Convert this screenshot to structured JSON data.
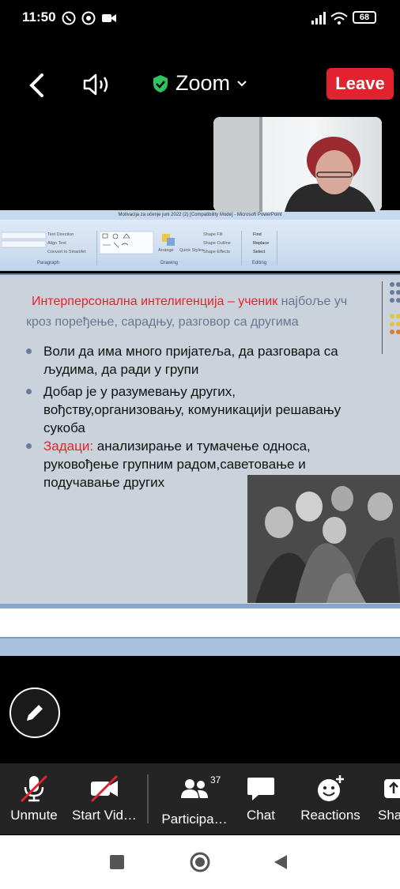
{
  "status_bar": {
    "time": "11:50",
    "battery": "68"
  },
  "top_bar": {
    "title": "Zoom",
    "leave_label": "Leave"
  },
  "ppt": {
    "window_title": "Motivacija za učenje juni 2022 (2) [Compatibility Mode] - Microsoft PowerPoint",
    "ribbon": {
      "paragraph_label": "Paragraph",
      "drawing_label": "Drawing",
      "editing_label": "Editing",
      "text_direction": "Text Direction",
      "align_text": "Align Text",
      "convert_smartart": "Convert to SmartArt",
      "arrange": "Arrange",
      "quick_styles": "Quick Styles",
      "shape_fill": "Shape Fill",
      "shape_outline": "Shape Outline",
      "shape_effects": "Shape Effects",
      "find": "Find",
      "replace": "Replace",
      "select": "Select"
    }
  },
  "slide": {
    "heading_red": "Интерперсонална интелигенција – ученик",
    "heading_rest": " најбоље уч",
    "heading_line2": "кроз поређење, сарадњу, разговор са другима",
    "bullets": [
      {
        "lines": [
          "Воли да има много пријатеља, да разговара са",
          "људима, да ради у групи"
        ]
      },
      {
        "lines": [
          "Добар је у разумевању других,",
          "вођству,организовању, комуникацији решавању",
          "сукоба"
        ]
      },
      {
        "label": "Задаци:",
        "lines": [
          "  анализирање и тумачење односа,",
          "руковођење групним радом,саветовање и",
          "подучавање других"
        ]
      }
    ]
  },
  "toolbar": {
    "unmute": "Unmute",
    "start_video": "Start Vid…",
    "participants": "Participa…",
    "participants_count": "37",
    "chat": "Chat",
    "reactions": "Reactions",
    "share": "Sha"
  }
}
